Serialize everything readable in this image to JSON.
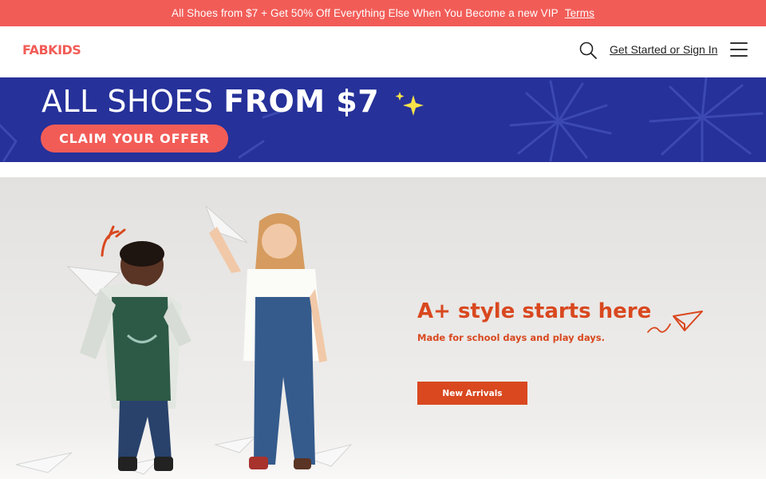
{
  "promo": {
    "message": "All Shoes from $7 + Get 50% Off Everything Else When You Become a new VIP",
    "terms_label": "Terms"
  },
  "header": {
    "logo": "FABKIDS",
    "signin_label": "Get Started or Sign In",
    "search_icon": "search-icon",
    "menu_icon": "hamburger-menu-icon"
  },
  "offer_banner": {
    "headline_regular": "ALL SHOES ",
    "headline_bold": "FROM $7",
    "cta_label": "CLAIM YOUR OFFER"
  },
  "hero": {
    "title": "A+ style starts here",
    "subtitle": "Made for school days and play days.",
    "cta_label": "New Arrivals"
  },
  "colors": {
    "brand_coral": "#f25c57",
    "banner_blue": "#26319a",
    "hero_orange": "#d9481f",
    "sparkle_yellow": "#f7e24a"
  }
}
